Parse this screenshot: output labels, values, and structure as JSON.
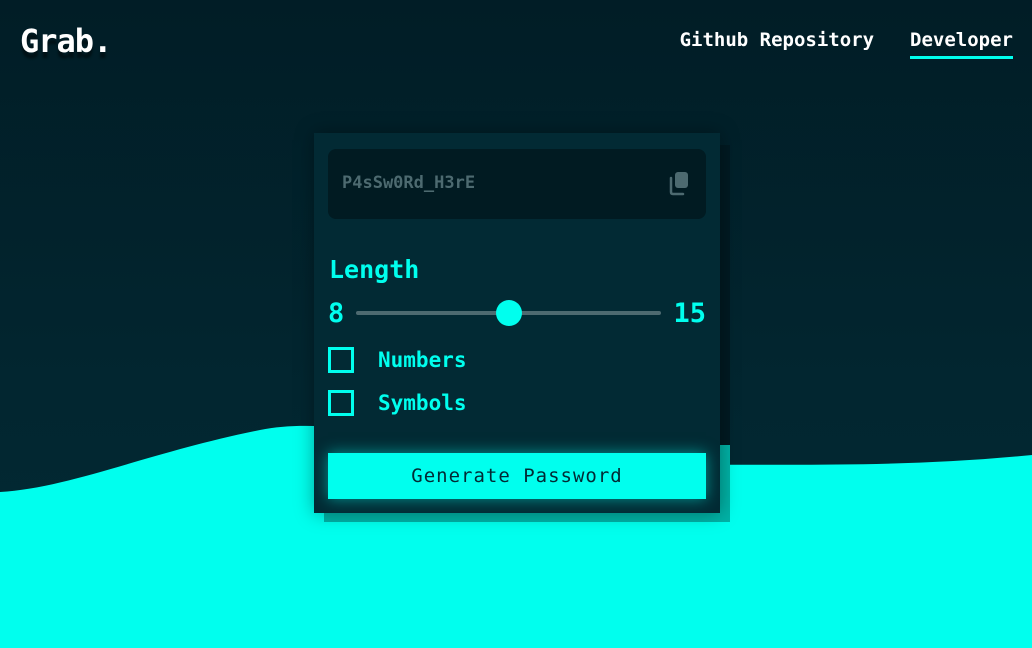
{
  "brand": "Grab.",
  "nav": {
    "github": "Github Repository",
    "developer": "Developer"
  },
  "password": {
    "value": "P4sSw0Rd_H3rE",
    "copy_icon": "copy-icon"
  },
  "length": {
    "label": "Length",
    "min": "8",
    "max": "15",
    "current": 11.5
  },
  "options": {
    "numbers": {
      "label": "Numbers",
      "checked": false
    },
    "symbols": {
      "label": "Symbols",
      "checked": false
    }
  },
  "generate_button": "Generate Password",
  "colors": {
    "background": "#022630",
    "accent": "#00ffee",
    "card": "#022a34",
    "muted": "#4d6a70"
  }
}
